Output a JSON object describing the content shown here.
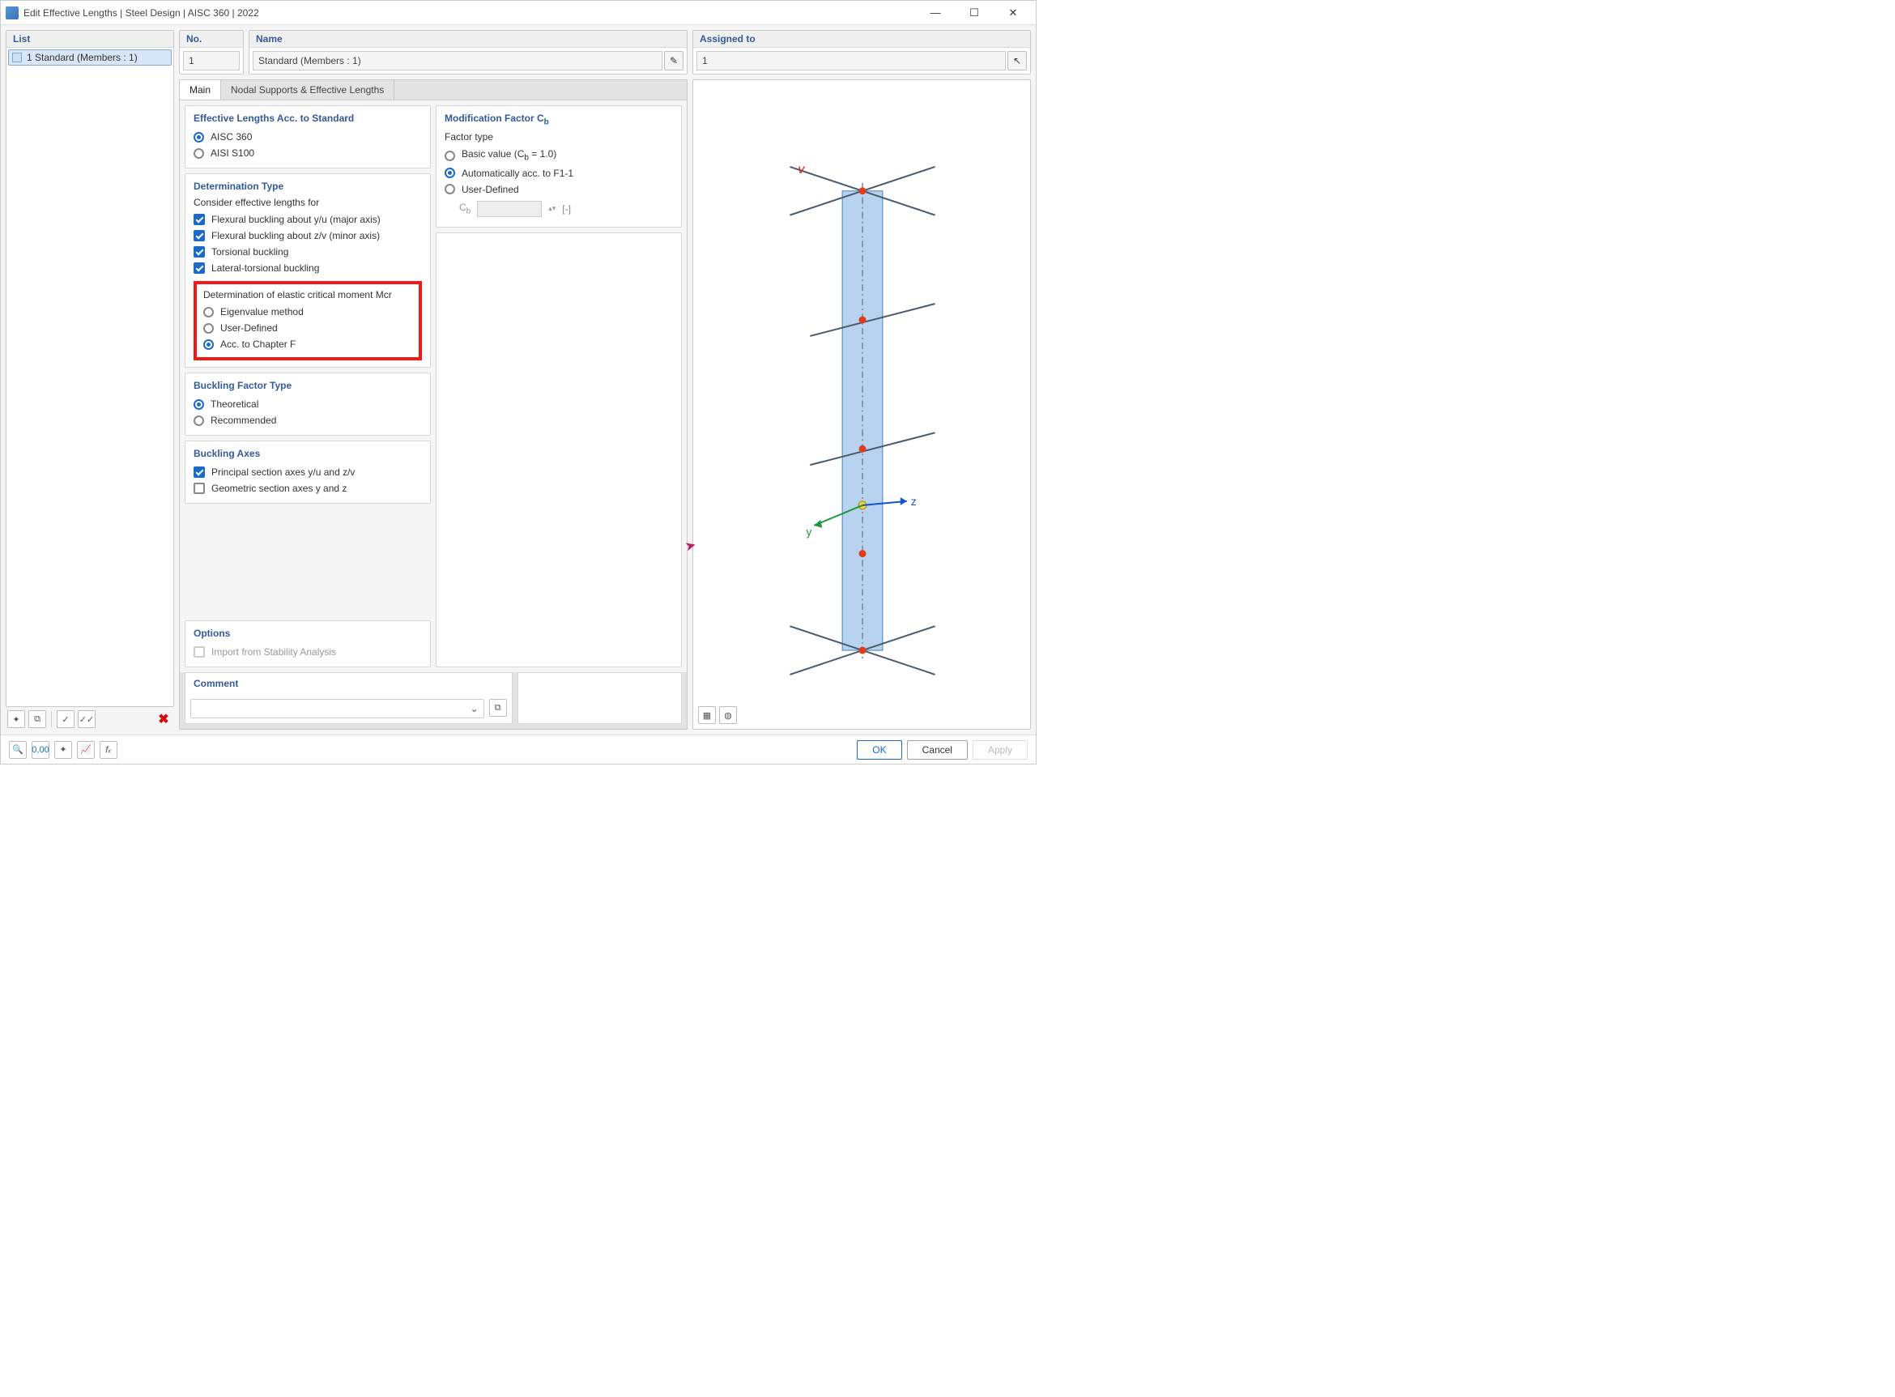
{
  "title": "Edit Effective Lengths | Steel Design | AISC 360 | 2022",
  "sidebar": {
    "header": "List",
    "item": "1 Standard (Members : 1)"
  },
  "no": {
    "header": "No.",
    "value": "1"
  },
  "name": {
    "header": "Name",
    "value": "Standard (Members : 1)"
  },
  "assigned": {
    "header": "Assigned to",
    "value": "1"
  },
  "tabs": {
    "main": "Main",
    "nodal": "Nodal Supports & Effective Lengths"
  },
  "eff_std": {
    "title": "Effective Lengths Acc. to Standard",
    "opts": {
      "aisc360": "AISC 360",
      "aisis100": "AISI S100"
    }
  },
  "det_type": {
    "title": "Determination Type",
    "sub": "Consider effective lengths for",
    "chk": {
      "fb_yu": "Flexural buckling about y/u (major axis)",
      "fb_zv": "Flexural buckling about z/v (minor axis)",
      "tors": "Torsional buckling",
      "ltb": "Lateral-torsional buckling"
    },
    "mcr_label": "Determination of elastic critical moment Mcr",
    "mcr": {
      "eigen": "Eigenvalue method",
      "user": "User-Defined",
      "chapf": "Acc. to Chapter F"
    }
  },
  "bf_type": {
    "title": "Buckling Factor Type",
    "theo": "Theoretical",
    "rec": "Recommended"
  },
  "axes": {
    "title": "Buckling Axes",
    "principal": "Principal section axes y/u and z/v",
    "geo": "Geometric section axes y and z"
  },
  "options": {
    "title": "Options",
    "import": "Import from Stability Analysis"
  },
  "cb": {
    "title": "Modification Factor Cb",
    "ftype": "Factor type",
    "basic": "Basic value (Cb = 1.0)",
    "auto": "Automatically acc. to F1-1",
    "user": "User-Defined",
    "cb_lab": "Cb",
    "unit": "[-]"
  },
  "comment": {
    "title": "Comment"
  },
  "buttons": {
    "ok": "OK",
    "cancel": "Cancel",
    "apply": "Apply"
  },
  "axis_labels": {
    "v": "v",
    "y": "y",
    "z": "z"
  }
}
